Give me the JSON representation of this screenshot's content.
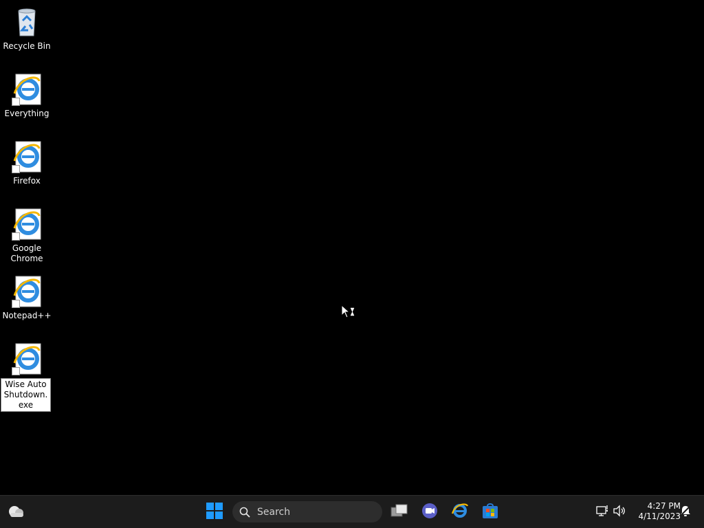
{
  "desktop": {
    "icons": [
      {
        "label": "Recycle Bin",
        "icon": "recycle-bin-icon"
      },
      {
        "label": "Everything",
        "icon": "ie-shortcut-icon"
      },
      {
        "label": "Firefox",
        "icon": "ie-shortcut-icon"
      },
      {
        "label": "Google Chrome",
        "icon": "ie-shortcut-icon"
      },
      {
        "label": "Notepad++",
        "icon": "ie-shortcut-icon"
      },
      {
        "label": "Wise Auto Shutdown.exe",
        "icon": "ie-shortcut-icon",
        "selected": true
      }
    ]
  },
  "taskbar": {
    "search_placeholder": "Search",
    "pinned": [
      "start-icon",
      "task-view-icon",
      "teams-chat-icon",
      "internet-explorer-icon",
      "microsoft-store-icon"
    ],
    "tray": [
      "network-icon",
      "volume-icon",
      "notification-icon"
    ],
    "time": "4:27 PM",
    "date": "4/11/2023"
  },
  "colors": {
    "desktop_bg": "#000000",
    "taskbar_bg": "#1c1c1c",
    "start_blue": "#0a84ff"
  }
}
